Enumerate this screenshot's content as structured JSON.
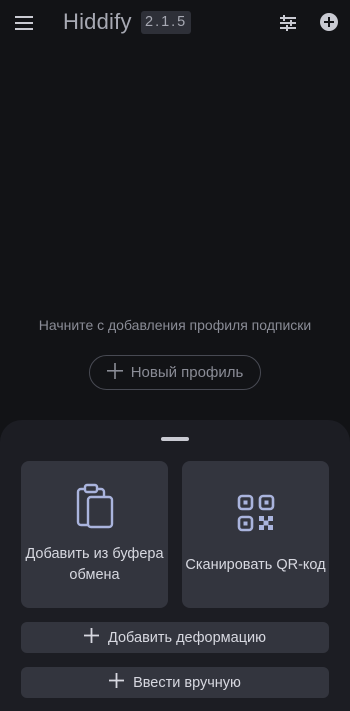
{
  "appbar": {
    "title": "Hiddify",
    "version": "2.1.5",
    "icons": [
      "menu-icon",
      "tune-icon",
      "add-circle-icon"
    ]
  },
  "empty_state": {
    "message": "Начните с добавления профиля подписки",
    "new_profile_label": "Новый профиль"
  },
  "sheet": {
    "clipboard_label": "Добавить из буфера обмена",
    "scan_qr_label": "Сканировать QR-код",
    "add_warp_label": "Добавить деформацию",
    "manual_label": "Ввести вручную"
  },
  "colors": {
    "background": "#121316",
    "sheet": "#1c1d23",
    "card": "#33353e",
    "icon_accent": "#aab4dd"
  }
}
